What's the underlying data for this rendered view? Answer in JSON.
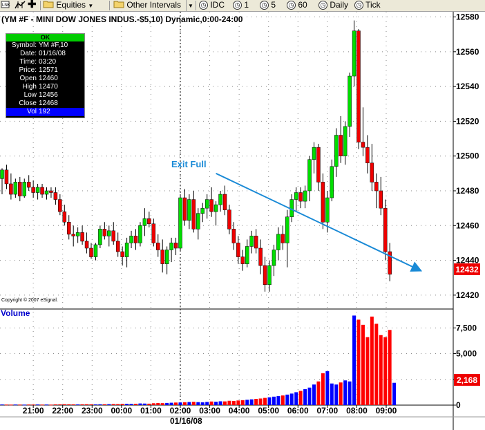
{
  "toolbar": {
    "items": [
      {
        "label": "Equities",
        "icon": "folder-icon",
        "dropdown": true
      },
      {
        "label": "Other Intervals",
        "icon": "folder-icon",
        "dropdown": true
      },
      {
        "label": "IDC",
        "icon": "clock-icon"
      },
      {
        "label": "1",
        "icon": "clock-icon"
      },
      {
        "label": "5",
        "icon": "clock-icon"
      },
      {
        "label": "60",
        "icon": "clock-icon"
      },
      {
        "label": "Daily",
        "icon": "clock-icon"
      },
      {
        "label": "Tick",
        "icon": "clock-icon"
      }
    ]
  },
  "info_box": {
    "status": "OK",
    "rows": [
      {
        "key": "Symbol:",
        "value": "YM #F,10"
      },
      {
        "key": "Date:",
        "value": "01/16/08"
      },
      {
        "key": "Time:",
        "value": "03:20"
      },
      {
        "key": "Price:",
        "value": "12571"
      },
      {
        "key": "Open",
        "value": "12460"
      },
      {
        "key": "High",
        "value": "12470"
      },
      {
        "key": "Low",
        "value": "12456"
      },
      {
        "key": "Close",
        "value": "12468"
      },
      {
        "key": "Vol",
        "value": "192"
      }
    ]
  },
  "colors": {
    "up": "#00dd00",
    "down": "#ee0000",
    "vol_up": "#0000ff",
    "vol_down": "#ff0000",
    "annotation": "#1a8ad6",
    "last_price_bg": "#ee0000"
  },
  "chart_data": {
    "type": "candlestick",
    "title": "(YM #F - MINI DOW JONES INDUS.-$5,10) Dynamic,0:00-24:00",
    "copyright": "Copyright © 2007 eSignal.",
    "volume_label": "Volume",
    "x_tick_labels": [
      "21:00",
      "22:00",
      "23:00",
      "00:00",
      "01:00",
      "02:00",
      "03:00",
      "04:00",
      "05:00",
      "06:00",
      "07:00",
      "08:00",
      "09:00"
    ],
    "date_label": "01/16/08",
    "price_axis": {
      "ylim": [
        12412,
        12583
      ],
      "ticks": [
        12420,
        12440,
        12460,
        12480,
        12500,
        12520,
        12540,
        12560,
        12580
      ]
    },
    "volume_axis": {
      "ylim": [
        0,
        9200
      ],
      "ticks": [
        0,
        2500,
        5000,
        7500
      ],
      "tick_labels": [
        "0",
        "2,500",
        "5,000",
        "7,500"
      ]
    },
    "last_price": "12432",
    "last_volume": "2,168",
    "annotation": {
      "text": "Exit Full",
      "from": {
        "bar": 48,
        "price": 12490
      },
      "to": {
        "bar": 94,
        "price": 12434
      }
    },
    "candles": [
      [
        12487,
        12493,
        12478,
        12492
      ],
      [
        12492,
        12495,
        12481,
        12484
      ],
      [
        12484,
        12490,
        12475,
        12478
      ],
      [
        12478,
        12487,
        12476,
        12485
      ],
      [
        12485,
        12488,
        12474,
        12477
      ],
      [
        12477,
        12487,
        12476,
        12485
      ],
      [
        12485,
        12489,
        12480,
        12482
      ],
      [
        12482,
        12486,
        12476,
        12479
      ],
      [
        12479,
        12484,
        12475,
        12482
      ],
      [
        12482,
        12484,
        12476,
        12478
      ],
      [
        12478,
        12482,
        12475,
        12480
      ],
      [
        12480,
        12482,
        12476,
        12479
      ],
      [
        12479,
        12482,
        12472,
        12475
      ],
      [
        12475,
        12478,
        12466,
        12468
      ],
      [
        12468,
        12472,
        12460,
        12462
      ],
      [
        12462,
        12466,
        12452,
        12455
      ],
      [
        12455,
        12460,
        12448,
        12454
      ],
      [
        12454,
        12459,
        12450,
        12456
      ],
      [
        12456,
        12460,
        12449,
        12451
      ],
      [
        12451,
        12456,
        12444,
        12447
      ],
      [
        12447,
        12450,
        12441,
        12442
      ],
      [
        12442,
        12450,
        12440,
        12449
      ],
      [
        12449,
        12460,
        12447,
        12458
      ],
      [
        12458,
        12462,
        12452,
        12454
      ],
      [
        12454,
        12460,
        12448,
        12457
      ],
      [
        12457,
        12462,
        12449,
        12451
      ],
      [
        12451,
        12456,
        12442,
        12445
      ],
      [
        12445,
        12448,
        12437,
        12442
      ],
      [
        12442,
        12453,
        12436,
        12450
      ],
      [
        12450,
        12457,
        12447,
        12454
      ],
      [
        12454,
        12458,
        12446,
        12450
      ],
      [
        12450,
        12462,
        12448,
        12460
      ],
      [
        12460,
        12470,
        12454,
        12464
      ],
      [
        12464,
        12468,
        12459,
        12461
      ],
      [
        12461,
        12464,
        12448,
        12450
      ],
      [
        12450,
        12455,
        12442,
        12446
      ],
      [
        12446,
        12452,
        12433,
        12438
      ],
      [
        12438,
        12448,
        12432,
        12446
      ],
      [
        12446,
        12453,
        12439,
        12450
      ],
      [
        12450,
        12453,
        12443,
        12447
      ],
      [
        12447,
        12478,
        12445,
        12476
      ],
      [
        12476,
        12481,
        12460,
        12463
      ],
      [
        12463,
        12478,
        12458,
        12475
      ],
      [
        12475,
        12480,
        12456,
        12458
      ],
      [
        12458,
        12470,
        12452,
        12467
      ],
      [
        12467,
        12473,
        12462,
        12470
      ],
      [
        12470,
        12478,
        12464,
        12475
      ],
      [
        12475,
        12482,
        12465,
        12468
      ],
      [
        12468,
        12474,
        12460,
        12472
      ],
      [
        12472,
        12480,
        12468,
        12478
      ],
      [
        12478,
        12483,
        12466,
        12469
      ],
      [
        12469,
        12472,
        12455,
        12458
      ],
      [
        12458,
        12462,
        12446,
        12450
      ],
      [
        12450,
        12454,
        12438,
        12442
      ],
      [
        12442,
        12446,
        12434,
        12438
      ],
      [
        12438,
        12452,
        12436,
        12448
      ],
      [
        12448,
        12457,
        12444,
        12454
      ],
      [
        12454,
        12458,
        12444,
        12447
      ],
      [
        12447,
        12452,
        12432,
        12437
      ],
      [
        12437,
        12442,
        12422,
        12426
      ],
      [
        12426,
        12440,
        12422,
        12437
      ],
      [
        12437,
        12449,
        12431,
        12446
      ],
      [
        12446,
        12459,
        12440,
        12455
      ],
      [
        12455,
        12460,
        12446,
        12450
      ],
      [
        12450,
        12469,
        12436,
        12465
      ],
      [
        12465,
        12478,
        12462,
        12475
      ],
      [
        12475,
        12482,
        12468,
        12479
      ],
      [
        12479,
        12482,
        12470,
        12474
      ],
      [
        12474,
        12483,
        12470,
        12480
      ],
      [
        12480,
        12500,
        12474,
        12498
      ],
      [
        12498,
        12508,
        12490,
        12505
      ],
      [
        12505,
        12507,
        12480,
        12485
      ],
      [
        12485,
        12490,
        12458,
        12462
      ],
      [
        12462,
        12480,
        12456,
        12476
      ],
      [
        12476,
        12498,
        12474,
        12494
      ],
      [
        12494,
        12516,
        12488,
        12512
      ],
      [
        12512,
        12523,
        12496,
        12500
      ],
      [
        12500,
        12520,
        12495,
        12517
      ],
      [
        12517,
        12548,
        12511,
        12546
      ],
      [
        12546,
        12578,
        12540,
        12572
      ],
      [
        12572,
        12573,
        12504,
        12508
      ],
      [
        12508,
        12528,
        12500,
        12505
      ],
      [
        12505,
        12512,
        12490,
        12496
      ],
      [
        12496,
        12507,
        12480,
        12485
      ],
      [
        12485,
        12490,
        12470,
        12480
      ],
      [
        12480,
        12488,
        12466,
        12470
      ],
      [
        12470,
        12475,
        12440,
        12445
      ],
      [
        12445,
        12450,
        12428,
        12432
      ]
    ],
    "volumes": [
      60,
      50,
      45,
      55,
      50,
      45,
      55,
      50,
      60,
      50,
      55,
      45,
      65,
      70,
      80,
      75,
      70,
      65,
      75,
      80,
      70,
      65,
      75,
      80,
      90,
      100,
      95,
      110,
      120,
      115,
      130,
      160,
      150,
      140,
      180,
      200,
      190,
      210,
      230,
      250,
      260,
      280,
      300,
      320,
      290,
      270,
      310,
      350,
      330,
      370,
      360,
      420,
      400,
      450,
      480,
      520,
      560,
      600,
      640,
      700,
      760,
      820,
      870,
      940,
      1020,
      1120,
      1250,
      1380,
      1550,
      1700,
      2000,
      2300,
      3100,
      3300,
      2100,
      2000,
      2200,
      2400,
      2300,
      8700,
      8300,
      7800,
      6600,
      8600,
      7900,
      6800,
      6600,
      7300,
      2168
    ]
  }
}
